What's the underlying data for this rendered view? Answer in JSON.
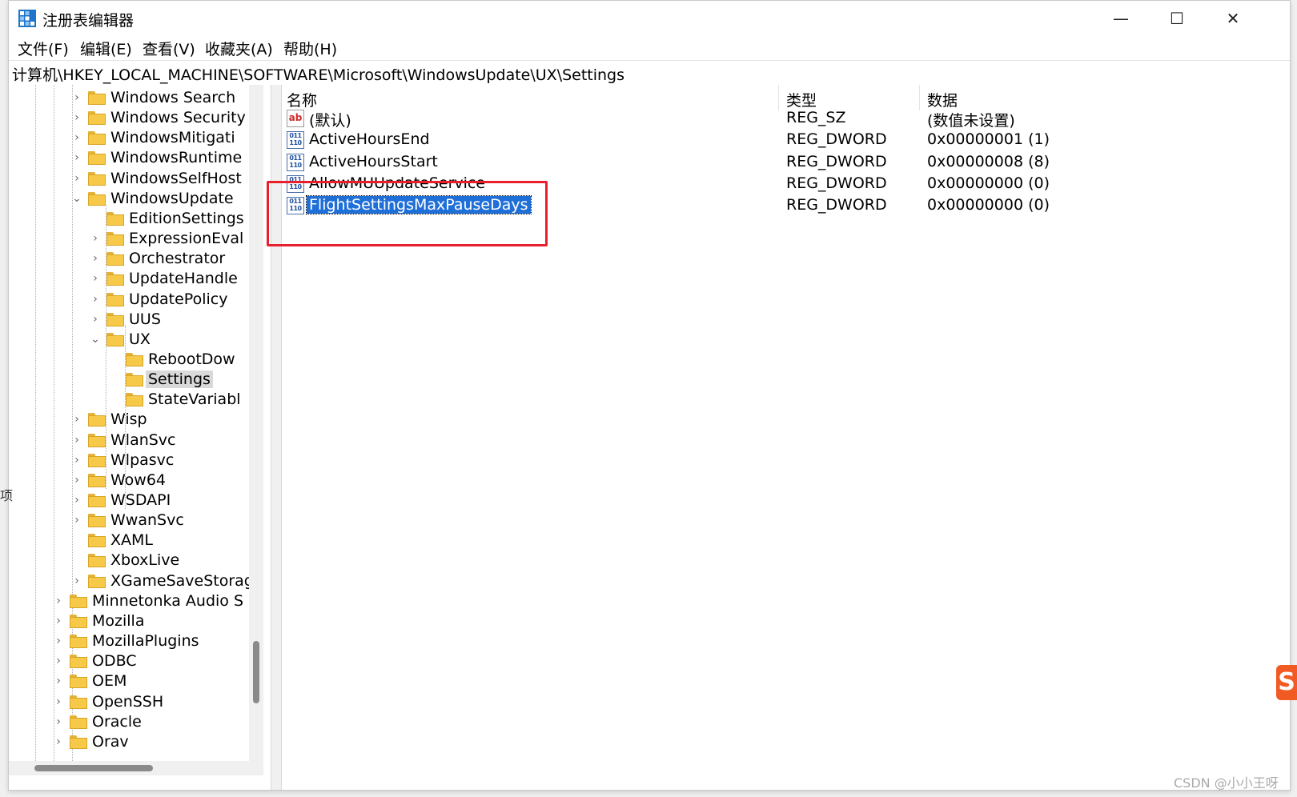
{
  "window": {
    "title": "注册表编辑器",
    "minimize_symbol": "—",
    "maximize_symbol": "☐",
    "close_symbol": "✕"
  },
  "menu": [
    "文件(F)",
    "编辑(E)",
    "查看(V)",
    "收藏夹(A)",
    "帮助(H)"
  ],
  "address": "计算机\\HKEY_LOCAL_MACHINE\\SOFTWARE\\Microsoft\\WindowsUpdate\\UX\\Settings",
  "tree": [
    {
      "label": "Windows Search",
      "level": 2,
      "expander": "collapsed"
    },
    {
      "label": "Windows Security",
      "level": 2,
      "expander": "collapsed"
    },
    {
      "label": "WindowsMitigati",
      "level": 2,
      "expander": "collapsed"
    },
    {
      "label": "WindowsRuntime",
      "level": 2,
      "expander": "collapsed"
    },
    {
      "label": "WindowsSelfHost",
      "level": 2,
      "expander": "collapsed"
    },
    {
      "label": "WindowsUpdate",
      "level": 2,
      "expander": "expanded"
    },
    {
      "label": "EditionSettings",
      "level": 3,
      "expander": "none"
    },
    {
      "label": "ExpressionEval",
      "level": 3,
      "expander": "collapsed"
    },
    {
      "label": "Orchestrator",
      "level": 3,
      "expander": "collapsed"
    },
    {
      "label": "UpdateHandle",
      "level": 3,
      "expander": "collapsed"
    },
    {
      "label": "UpdatePolicy",
      "level": 3,
      "expander": "collapsed"
    },
    {
      "label": "UUS",
      "level": 3,
      "expander": "collapsed"
    },
    {
      "label": "UX",
      "level": 3,
      "expander": "expanded"
    },
    {
      "label": "RebootDow",
      "level": 4,
      "expander": "none"
    },
    {
      "label": "Settings",
      "level": 4,
      "expander": "none",
      "selected": true
    },
    {
      "label": "StateVariabl",
      "level": 4,
      "expander": "none"
    },
    {
      "label": "Wisp",
      "level": 2,
      "expander": "collapsed"
    },
    {
      "label": "WlanSvc",
      "level": 2,
      "expander": "collapsed"
    },
    {
      "label": "Wlpasvc",
      "level": 2,
      "expander": "collapsed"
    },
    {
      "label": "Wow64",
      "level": 2,
      "expander": "collapsed"
    },
    {
      "label": "WSDAPI",
      "level": 2,
      "expander": "collapsed"
    },
    {
      "label": "WwanSvc",
      "level": 2,
      "expander": "collapsed"
    },
    {
      "label": "XAML",
      "level": 2,
      "expander": "none"
    },
    {
      "label": "XboxLive",
      "level": 2,
      "expander": "none"
    },
    {
      "label": "XGameSaveStorag",
      "level": 2,
      "expander": "collapsed"
    },
    {
      "label": "Minnetonka Audio S",
      "level": 1,
      "expander": "collapsed"
    },
    {
      "label": "Mozilla",
      "level": 1,
      "expander": "collapsed"
    },
    {
      "label": "MozillaPlugins",
      "level": 1,
      "expander": "collapsed"
    },
    {
      "label": "ODBC",
      "level": 1,
      "expander": "collapsed"
    },
    {
      "label": "OEM",
      "level": 1,
      "expander": "collapsed"
    },
    {
      "label": "OpenSSH",
      "level": 1,
      "expander": "collapsed"
    },
    {
      "label": "Oracle",
      "level": 1,
      "expander": "collapsed"
    },
    {
      "label": "Orav",
      "level": 1,
      "expander": "collapsed"
    }
  ],
  "list": {
    "columns": {
      "name": "名称",
      "type": "类型",
      "data": "数据"
    },
    "rows": [
      {
        "icon": "string-value-icon",
        "icon_text": "ab",
        "name": "(默认)",
        "type": "REG_SZ",
        "data": "(数值未设置)"
      },
      {
        "icon": "binary-value-icon",
        "icon_text": "011\n110",
        "name": "ActiveHoursEnd",
        "type": "REG_DWORD",
        "data": "0x00000001 (1)"
      },
      {
        "icon": "binary-value-icon",
        "icon_text": "011\n110",
        "name": "ActiveHoursStart",
        "type": "REG_DWORD",
        "data": "0x00000008 (8)"
      },
      {
        "icon": "binary-value-icon",
        "icon_text": "011\n110",
        "name": "AllowMUUpdateService",
        "type": "REG_DWORD",
        "data": "0x00000000 (0)"
      },
      {
        "icon": "binary-value-icon",
        "icon_text": "011\n110",
        "name": "FlightSettingsMaxPauseDays",
        "type": "REG_DWORD",
        "data": "0x00000000 (0)",
        "selected": true
      }
    ]
  },
  "watermark": "CSDN @小小王呀",
  "overlay": {
    "sogou_glyph": "S",
    "left_edge_glyph": "项"
  },
  "colors": {
    "selection": "#1f6fd9",
    "highlight_box": "#e8202e",
    "folder": "#f7c948"
  }
}
